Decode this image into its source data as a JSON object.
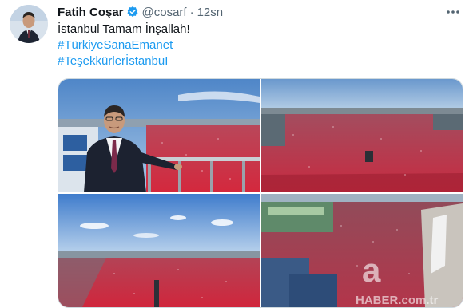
{
  "tweet": {
    "author_name": "Fatih Coşar",
    "handle": "@cosarf",
    "separator": "·",
    "time": "12sn",
    "text_line": "İstanbul Tamam İnşallah!",
    "hashtags": [
      "#TürkiyeSanaEmanet",
      "#TeşekkürlerİstanbuI"
    ],
    "icons": {
      "verified": "verified-badge-icon",
      "more": "more-options-icon"
    },
    "colors": {
      "link": "#1d9bf0",
      "verified": "#1d9bf0",
      "secondary_text": "#536471",
      "crowd": "#c8283a"
    }
  },
  "watermark": {
    "logo_letter": "a",
    "text": "HABER.com.tr"
  }
}
